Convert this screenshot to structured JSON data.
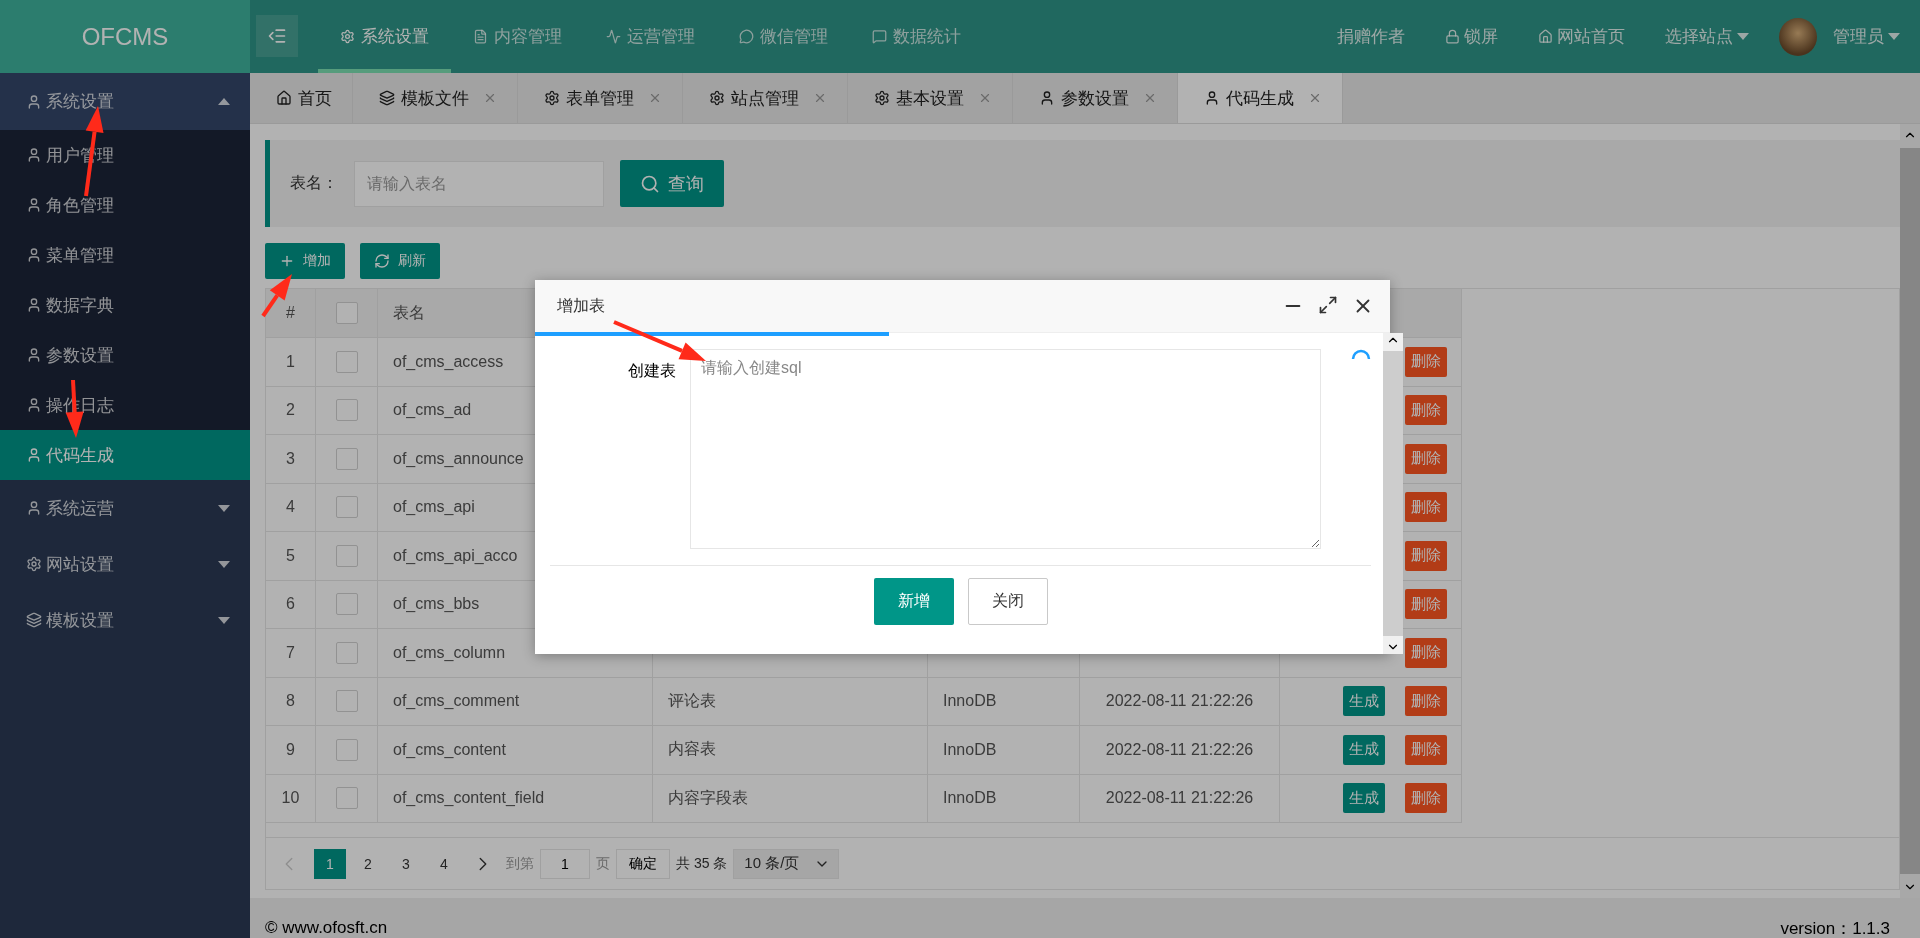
{
  "app": {
    "logo": "OFCMS"
  },
  "top_nav": [
    {
      "label": "系统设置",
      "selected": true
    },
    {
      "label": "内容管理",
      "selected": false
    },
    {
      "label": "运营管理",
      "selected": false
    },
    {
      "label": "微信管理",
      "selected": false
    },
    {
      "label": "数据统计",
      "selected": false
    }
  ],
  "top_right": [
    {
      "label": "捐赠作者",
      "dropdown": false
    },
    {
      "label": "锁屏",
      "dropdown": false
    },
    {
      "label": "网站首页",
      "dropdown": false
    },
    {
      "label": "选择站点",
      "dropdown": true
    }
  ],
  "user": {
    "name": "管理员",
    "dropdown": true
  },
  "sidebar": [
    {
      "label": "系统设置",
      "expanded": true,
      "children": [
        {
          "label": "用户管理",
          "selected": false
        },
        {
          "label": "角色管理",
          "selected": false
        },
        {
          "label": "菜单管理",
          "selected": false
        },
        {
          "label": "数据字典",
          "selected": false
        },
        {
          "label": "参数设置",
          "selected": false
        },
        {
          "label": "操作日志",
          "selected": false
        },
        {
          "label": "代码生成",
          "selected": true
        }
      ]
    },
    {
      "label": "系统运营",
      "expanded": false
    },
    {
      "label": "网站设置",
      "expanded": false
    },
    {
      "label": "模板设置",
      "expanded": false
    }
  ],
  "tabs": [
    {
      "label": "首页",
      "closable": false,
      "selected": false
    },
    {
      "label": "模板文件",
      "closable": true,
      "selected": false
    },
    {
      "label": "表单管理",
      "closable": true,
      "selected": false
    },
    {
      "label": "站点管理",
      "closable": true,
      "selected": false
    },
    {
      "label": "基本设置",
      "closable": true,
      "selected": false
    },
    {
      "label": "参数设置",
      "closable": true,
      "selected": false
    },
    {
      "label": "代码生成",
      "closable": true,
      "selected": true
    }
  ],
  "search": {
    "label": "表名：",
    "placeholder": "请输入表名",
    "button": "查询"
  },
  "toolbar": [
    {
      "label": "增加"
    },
    {
      "label": "刷新"
    }
  ],
  "table": {
    "columns": [
      {
        "kind": "text",
        "label": "#"
      },
      {
        "kind": "checkbox",
        "checked": false
      },
      {
        "kind": "text",
        "label": "表名"
      }
    ],
    "rows": [
      {
        "index": "1",
        "checked": false,
        "name": "of_cms_access",
        "actions": [
          {
            "kind": "delete",
            "label": "删除"
          }
        ]
      },
      {
        "index": "2",
        "checked": false,
        "name": "of_cms_ad",
        "actions": [
          {
            "kind": "delete",
            "label": "删除"
          }
        ]
      },
      {
        "index": "3",
        "checked": false,
        "name": "of_cms_announce",
        "actions": [
          {
            "kind": "delete",
            "label": "删除"
          }
        ]
      },
      {
        "index": "4",
        "checked": false,
        "name": "of_cms_api",
        "actions": [
          {
            "kind": "delete",
            "label": "删除"
          }
        ]
      },
      {
        "index": "5",
        "checked": false,
        "name": "of_cms_api_acco",
        "actions": [
          {
            "kind": "delete",
            "label": "删除"
          }
        ]
      },
      {
        "index": "6",
        "checked": false,
        "name": "of_cms_bbs",
        "actions": [
          {
            "kind": "delete",
            "label": "删除"
          }
        ]
      },
      {
        "index": "7",
        "checked": false,
        "name": "of_cms_column",
        "actions": [
          {
            "kind": "delete",
            "label": "删除"
          }
        ]
      },
      {
        "index": "8",
        "checked": false,
        "name": "of_cms_comment",
        "comment": "评论表",
        "engine": "InnoDB",
        "time": "2022-08-11 21:22:26",
        "actions": [
          {
            "kind": "generate",
            "label": "生成"
          },
          {
            "kind": "delete",
            "label": "删除"
          }
        ]
      },
      {
        "index": "9",
        "checked": false,
        "name": "of_cms_content",
        "comment": "内容表",
        "engine": "InnoDB",
        "time": "2022-08-11 21:22:26",
        "actions": [
          {
            "kind": "generate",
            "label": "生成"
          },
          {
            "kind": "delete",
            "label": "删除"
          }
        ]
      },
      {
        "index": "10",
        "checked": false,
        "name": "of_cms_content_field",
        "comment": "内容字段表",
        "engine": "InnoDB",
        "time": "2022-08-11 21:22:26",
        "actions": [
          {
            "kind": "generate",
            "label": "生成"
          },
          {
            "kind": "delete",
            "label": "删除"
          }
        ]
      }
    ]
  },
  "pagination": {
    "prev_disabled": true,
    "pages": [
      {
        "label": "1",
        "selected": true
      },
      {
        "label": "2",
        "selected": false
      },
      {
        "label": "3",
        "selected": false
      },
      {
        "label": "4",
        "selected": false
      }
    ],
    "goto_label": "到第",
    "goto_value": "1",
    "page_label": "页",
    "confirm": "确定",
    "total": "共 35 条",
    "page_size": "10 条/页"
  },
  "footer": {
    "copyright": "© www.ofosft.cn",
    "version": "version：1.1.3"
  },
  "dialog": {
    "title": "增加表",
    "field_label": "创建表",
    "placeholder": "请输入创建sql",
    "loading": true,
    "buttons": [
      {
        "label": "新增",
        "kind": "primary"
      },
      {
        "label": "关闭",
        "kind": "default"
      }
    ]
  }
}
